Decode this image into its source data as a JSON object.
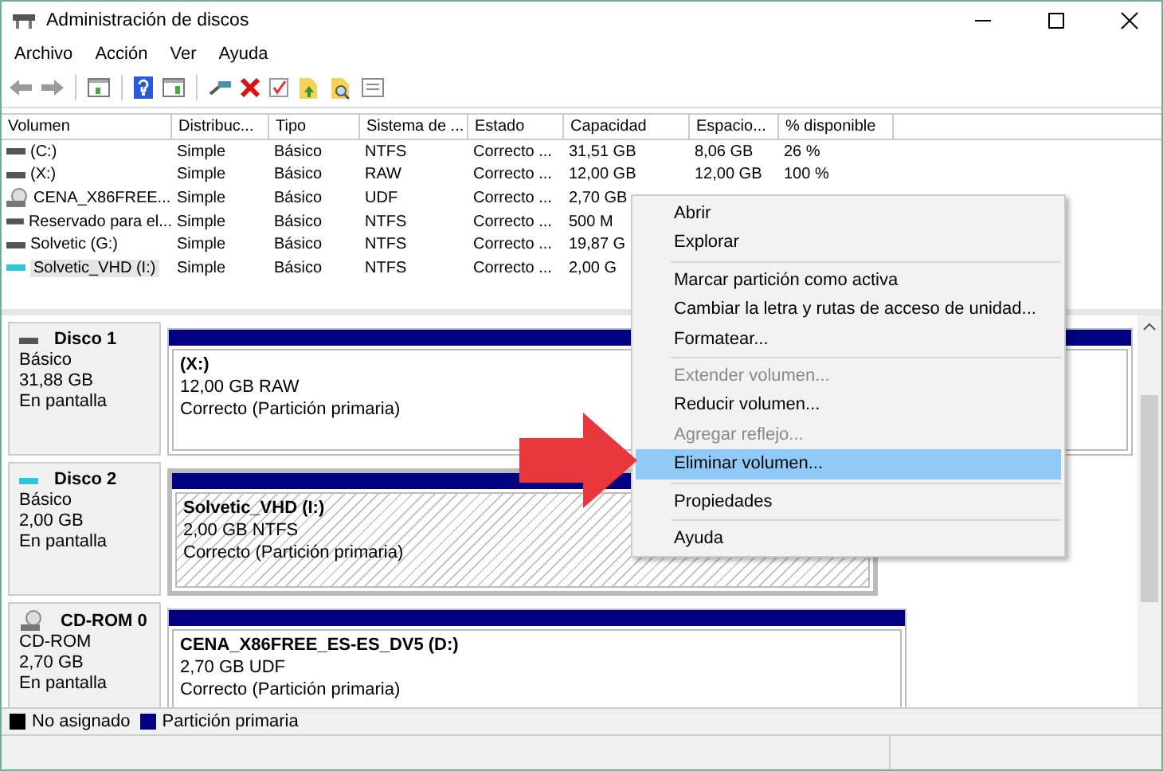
{
  "window": {
    "title": "Administración de discos"
  },
  "menu": [
    "Archivo",
    "Acción",
    "Ver",
    "Ayuda"
  ],
  "table": {
    "columns": [
      "Volumen",
      "Distribuc...",
      "Tipo",
      "Sistema de ...",
      "Estado",
      "Capacidad",
      "Espacio...",
      "% disponible"
    ],
    "rows": [
      {
        "kind": "disk",
        "selected": false,
        "cells": [
          "(C:)",
          "Simple",
          "Básico",
          "NTFS",
          "Correcto ...",
          "31,51 GB",
          "8,06 GB",
          "26 %"
        ]
      },
      {
        "kind": "disk",
        "selected": false,
        "cells": [
          "(X:)",
          "Simple",
          "Básico",
          "RAW",
          "Correcto ...",
          "12,00 GB",
          "12,00 GB",
          "100 %"
        ]
      },
      {
        "kind": "cd",
        "selected": false,
        "cells": [
          "CENA_X86FREE...",
          "Simple",
          "Básico",
          "UDF",
          "Correcto ...",
          "2,70 GB"
        ]
      },
      {
        "kind": "disk",
        "selected": false,
        "cells": [
          "Reservado para el...",
          "Simple",
          "Básico",
          "NTFS",
          "Correcto ...",
          "500 M"
        ]
      },
      {
        "kind": "disk",
        "selected": false,
        "cells": [
          "Solvetic (G:)",
          "Simple",
          "Básico",
          "NTFS",
          "Correcto ...",
          "19,87 G"
        ]
      },
      {
        "kind": "vhd",
        "selected": true,
        "cells": [
          "Solvetic_VHD (I:)",
          "Simple",
          "Básico",
          "NTFS",
          "Correcto ...",
          "2,00 G"
        ]
      }
    ]
  },
  "disks": [
    {
      "kind": "disk",
      "name": "Disco 1",
      "type": "Básico",
      "size": "31,88 GB",
      "status": "En pantalla",
      "partitions": [
        {
          "label": "(X:)",
          "size": "12,00 GB RAW",
          "status": "Correcto (Partición primaria)",
          "selected": false
        }
      ]
    },
    {
      "kind": "vhd",
      "name": "Disco 2",
      "type": "Básico",
      "size": "2,00 GB",
      "status": "En pantalla",
      "partitions": [
        {
          "label": "Solvetic_VHD  (I:)",
          "size": "2,00 GB NTFS",
          "status": "Correcto (Partición primaria)",
          "selected": true
        }
      ]
    },
    {
      "kind": "cd",
      "name": "CD-ROM 0",
      "type": "CD-ROM",
      "size": "2,70 GB",
      "status": "En pantalla",
      "partitions": [
        {
          "label": "CENA_X86FREE_ES-ES_DV5  (D:)",
          "size": "2,70 GB UDF",
          "status": "Correcto (Partición primaria)",
          "selected": false
        }
      ]
    }
  ],
  "legend": [
    {
      "label": "No asignado",
      "color": "#000000"
    },
    {
      "label": "Partición primaria",
      "color": "#000080"
    }
  ],
  "context_menu": {
    "groups": [
      [
        {
          "label": "Abrir",
          "disabled": false,
          "selected": false
        },
        {
          "label": "Explorar",
          "disabled": false,
          "selected": false
        }
      ],
      [
        {
          "label": "Marcar partición como activa",
          "disabled": false,
          "selected": false
        },
        {
          "label": "Cambiar la letra y rutas de acceso de unidad...",
          "disabled": false,
          "selected": false
        },
        {
          "label": "Formatear...",
          "disabled": false,
          "selected": false
        }
      ],
      [
        {
          "label": "Extender volumen...",
          "disabled": true,
          "selected": false
        },
        {
          "label": "Reducir volumen...",
          "disabled": false,
          "selected": false
        },
        {
          "label": "Agregar reflejo...",
          "disabled": true,
          "selected": false
        },
        {
          "label": "Eliminar volumen...",
          "disabled": false,
          "selected": true
        }
      ],
      [
        {
          "label": "Propiedades",
          "disabled": false,
          "selected": false
        }
      ],
      [
        {
          "label": "Ayuda",
          "disabled": false,
          "selected": false
        }
      ]
    ]
  }
}
